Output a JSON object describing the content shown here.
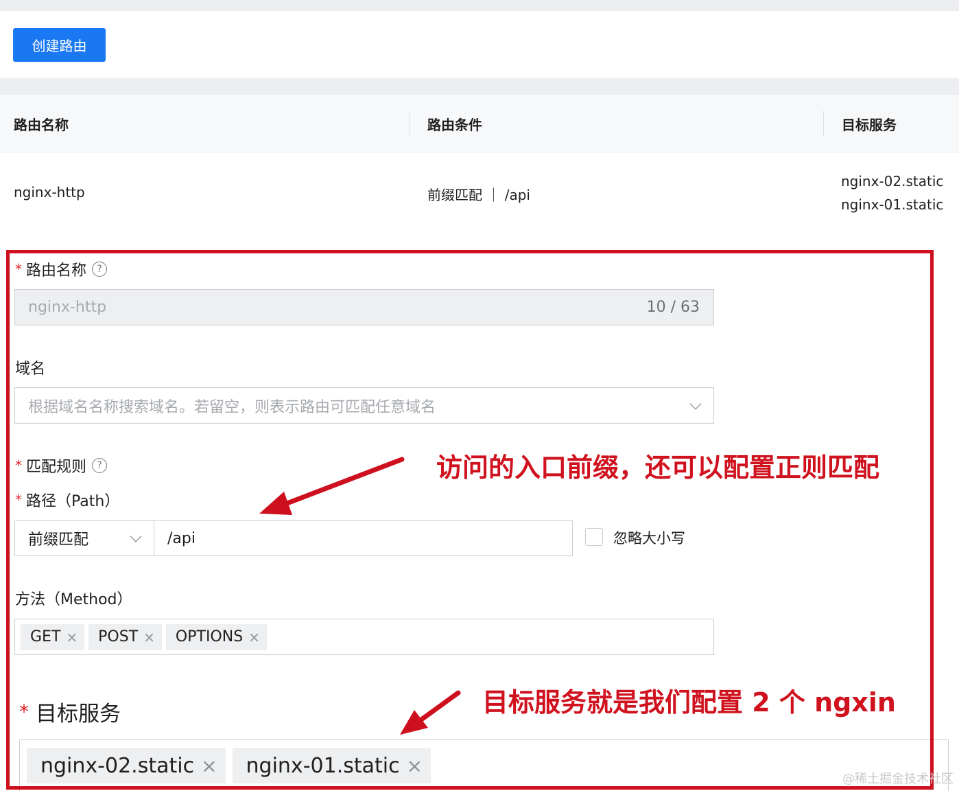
{
  "toolbar": {
    "create_label": "创建路由"
  },
  "table": {
    "headers": [
      "路由名称",
      "路由条件",
      "目标服务"
    ],
    "row": {
      "name": "nginx-http",
      "condition": "前缀匹配 ｜ /api",
      "targets": [
        "nginx-02.static",
        "nginx-01.static"
      ]
    }
  },
  "form": {
    "route_name": {
      "label": "路由名称",
      "value": "nginx-http",
      "counter": "10 / 63"
    },
    "domain": {
      "label": "域名",
      "placeholder": "根据域名名称搜索域名。若留空，则表示路由可匹配任意域名"
    },
    "match_rule": {
      "label": "匹配规则"
    },
    "path": {
      "label": "路径（Path）",
      "match_type": "前缀匹配",
      "value": "/api",
      "ignore_case_label": "忽略大小写",
      "ignore_case_checked": false
    },
    "method": {
      "label": "方法（Method）",
      "tags": [
        "GET",
        "POST",
        "OPTIONS"
      ]
    },
    "target": {
      "label": "目标服务",
      "tags": [
        "nginx-02.static",
        "nginx-01.static"
      ]
    },
    "required_mark": "*"
  },
  "annotations": {
    "match_note": "访问的入口前缀，还可以配置正则匹配",
    "target_note": "目标服务就是我们配置 2 个 ngxin"
  },
  "watermark": "@稀土掘金技术社区",
  "colors": {
    "primary": "#1a78f2",
    "annotation_red": "#cd0f1e",
    "required": "#e0242a"
  },
  "icons": {
    "help": "question-circle-icon",
    "dropdown": "chevron-down-icon",
    "remove": "close-icon",
    "arrow": "red-arrow"
  }
}
